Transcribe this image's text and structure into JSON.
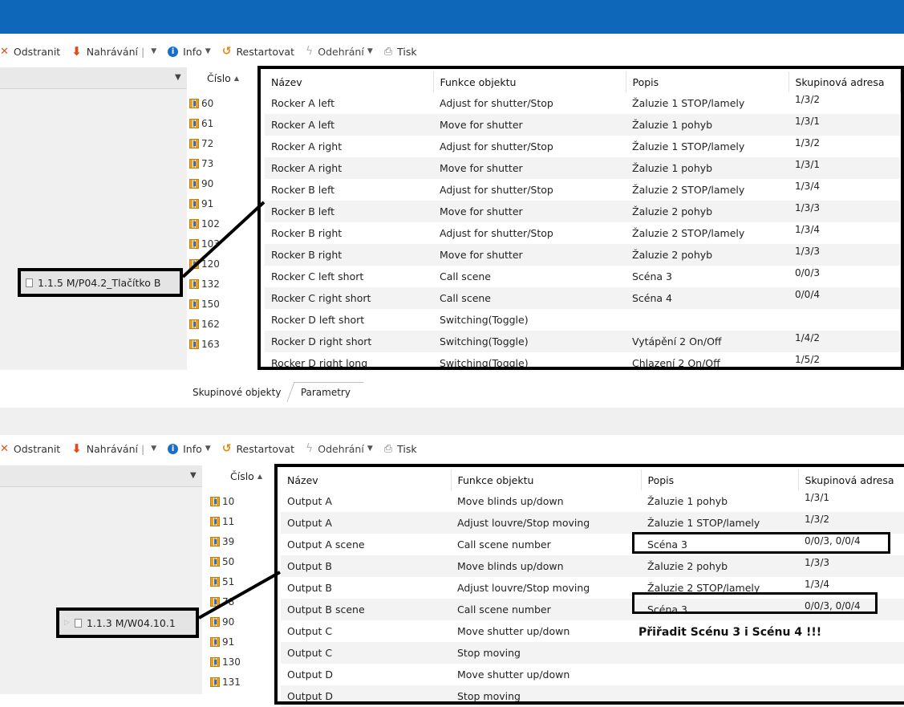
{
  "toolbar": {
    "remove": "Odstranit",
    "upload": "Nahrávání",
    "info": "Info",
    "restart": "Restartovat",
    "unload": "Odehrání",
    "print": "Tisk",
    "separator": "|"
  },
  "top": {
    "device_label": "1.1.5 M/P04.2_Tlačítko B",
    "columns": {
      "number": "Číslo",
      "sort": "▲",
      "name": "Název",
      "function": "Funkce objektu",
      "description": "Popis",
      "group_address": "Skupinová adresa"
    },
    "rows": [
      {
        "number": "60",
        "name": "Rocker A left",
        "function": "Adjust for shutter/Stop",
        "description": "Žaluzie 1 STOP/lamely",
        "address": "1/3/2"
      },
      {
        "number": "61",
        "name": "Rocker A left",
        "function": "Move for shutter",
        "description": "Žaluzie 1 pohyb",
        "address": "1/3/1"
      },
      {
        "number": "72",
        "name": "Rocker A right",
        "function": "Adjust for shutter/Stop",
        "description": "Žaluzie 1 STOP/lamely",
        "address": "1/3/2"
      },
      {
        "number": "73",
        "name": "Rocker A right",
        "function": "Move for shutter",
        "description": "Žaluzie 1 pohyb",
        "address": "1/3/1"
      },
      {
        "number": "90",
        "name": "Rocker B left",
        "function": "Adjust for shutter/Stop",
        "description": "Žaluzie 2 STOP/lamely",
        "address": "1/3/4"
      },
      {
        "number": "91",
        "name": "Rocker B left",
        "function": "Move for shutter",
        "description": "Žaluzie 2 pohyb",
        "address": "1/3/3"
      },
      {
        "number": "102",
        "name": "Rocker B right",
        "function": "Adjust for shutter/Stop",
        "description": "Žaluzie 2 STOP/lamely",
        "address": "1/3/4"
      },
      {
        "number": "103",
        "name": "Rocker B right",
        "function": "Move for shutter",
        "description": "Žaluzie 2 pohyb",
        "address": "1/3/3"
      },
      {
        "number": "120",
        "name": "Rocker C left short",
        "function": "Call scene",
        "description": "Scéna 3",
        "address": "0/0/3"
      },
      {
        "number": "132",
        "name": "Rocker C right short",
        "function": "Call scene",
        "description": "Scéna 4",
        "address": "0/0/4"
      },
      {
        "number": "150",
        "name": "Rocker D left short",
        "function": "Switching(Toggle)",
        "description": "",
        "address": ""
      },
      {
        "number": "162",
        "name": "Rocker D right short",
        "function": "Switching(Toggle)",
        "description": "Vytápění 2 On/Off",
        "address": "1/4/2"
      },
      {
        "number": "163",
        "name": "Rocker D right long",
        "function": "Switching(Toggle)",
        "description": "Chlazení 2 On/Off",
        "address": "1/5/2"
      }
    ],
    "tabs": [
      "Skupinové objekty",
      "Parametry"
    ]
  },
  "bottom": {
    "device_label": "1.1.3 M/W04.10.1",
    "columns": {
      "number": "Číslo",
      "sort": "▲",
      "name": "Název",
      "function": "Funkce objektu",
      "description": "Popis",
      "group_address": "Skupinová adresa"
    },
    "rows": [
      {
        "number": "10",
        "name": "Output A",
        "function": "Move blinds up/down",
        "description": "Žaluzie 1 pohyb",
        "address": "1/3/1"
      },
      {
        "number": "11",
        "name": "Output A",
        "function": "Adjust louvre/Stop moving",
        "description": "Žaluzie 1 STOP/lamely",
        "address": "1/3/2"
      },
      {
        "number": "39",
        "name": "Output A scene",
        "function": "Call scene number",
        "description": "Scéna 3",
        "address": "0/0/3, 0/0/4"
      },
      {
        "number": "50",
        "name": "Output B",
        "function": "Move blinds up/down",
        "description": "Žaluzie 2 pohyb",
        "address": "1/3/3"
      },
      {
        "number": "51",
        "name": "Output B",
        "function": "Adjust louvre/Stop moving",
        "description": "Žaluzie 2 STOP/lamely",
        "address": "1/3/4"
      },
      {
        "number": "78",
        "name": "Output B scene",
        "function": "Call scene number",
        "description": "Scéna 3",
        "address": "0/0/3, 0/0/4"
      },
      {
        "number": "90",
        "name": "Output C",
        "function": "Move shutter up/down",
        "description": "",
        "address": ""
      },
      {
        "number": "91",
        "name": "Output C",
        "function": "Stop moving",
        "description": "",
        "address": ""
      },
      {
        "number": "130",
        "name": "Output D",
        "function": "Move shutter up/down",
        "description": "",
        "address": ""
      },
      {
        "number": "131",
        "name": "Output D",
        "function": "Stop moving",
        "description": "",
        "address": ""
      }
    ],
    "note": "Přiřadit Scénu 3 i Scénu 4 !!!"
  }
}
